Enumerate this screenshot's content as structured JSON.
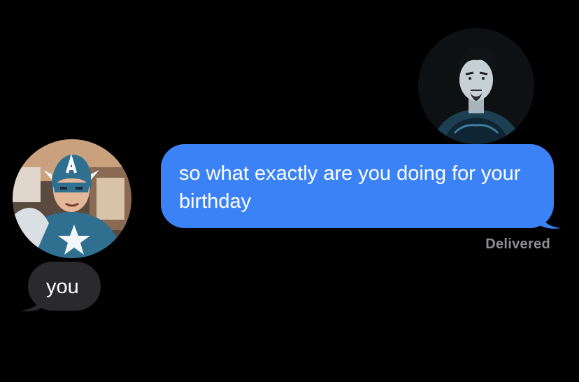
{
  "conversation": {
    "outgoing": {
      "text": "so what exactly are you doing for your birthday",
      "status": "Delivered"
    },
    "incoming": {
      "text": "you"
    }
  },
  "avatars": {
    "left": {
      "icon": "captain-america-avatar-icon"
    },
    "right": {
      "icon": "tony-stark-avatar-icon"
    }
  },
  "colors": {
    "background": "#000000",
    "outgoing_bubble": "#3b82f6",
    "incoming_bubble": "#2a2a2c",
    "status_text": "#8e8e93"
  }
}
